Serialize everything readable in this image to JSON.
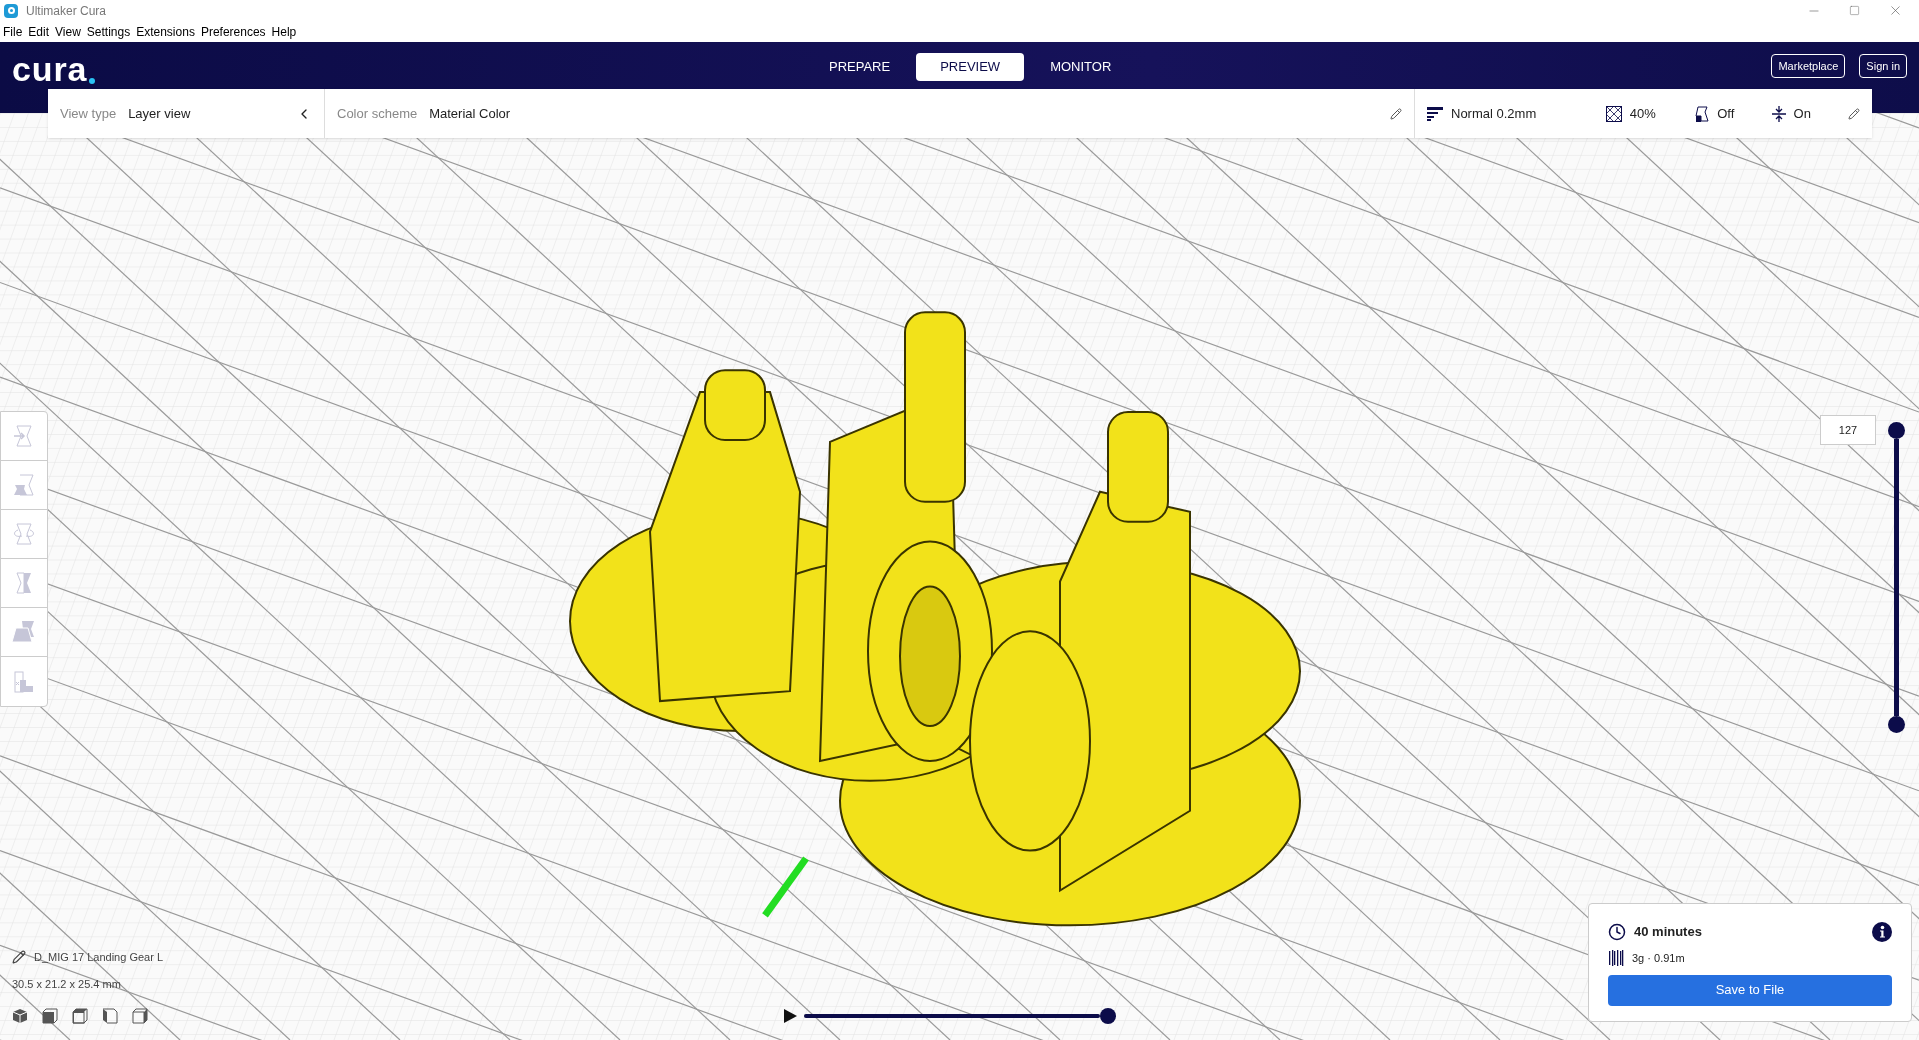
{
  "window": {
    "title": "Ultimaker Cura"
  },
  "menu": [
    "File",
    "Edit",
    "View",
    "Settings",
    "Extensions",
    "Preferences",
    "Help"
  ],
  "header": {
    "logo": "cura",
    "tabs": [
      {
        "label": "PREPARE",
        "selected": false
      },
      {
        "label": "PREVIEW",
        "selected": true
      },
      {
        "label": "MONITOR",
        "selected": false
      }
    ],
    "buttons": [
      "Marketplace",
      "Sign in"
    ]
  },
  "view_toolbar": {
    "view_type": {
      "label": "View type",
      "value": "Layer view"
    },
    "color_scheme": {
      "label": "Color scheme",
      "value": "Material Color"
    },
    "print_settings": [
      {
        "kind": "profile",
        "value": "Normal 0.2mm"
      },
      {
        "kind": "infill",
        "value": "40%"
      },
      {
        "kind": "support",
        "value": "Off"
      },
      {
        "kind": "adhesion",
        "value": "On"
      }
    ]
  },
  "layer_slider": {
    "reading": "127",
    "level": 1
  },
  "object_info": {
    "name": "D_MIG 17 Landing Gear L",
    "dimensions": "30.5 x 21.2 x 25.4 mm"
  },
  "simulation": {
    "level": 1
  },
  "print_info": {
    "time": "40 minutes",
    "material": "3g · 0.91m",
    "button": "Save to File"
  }
}
